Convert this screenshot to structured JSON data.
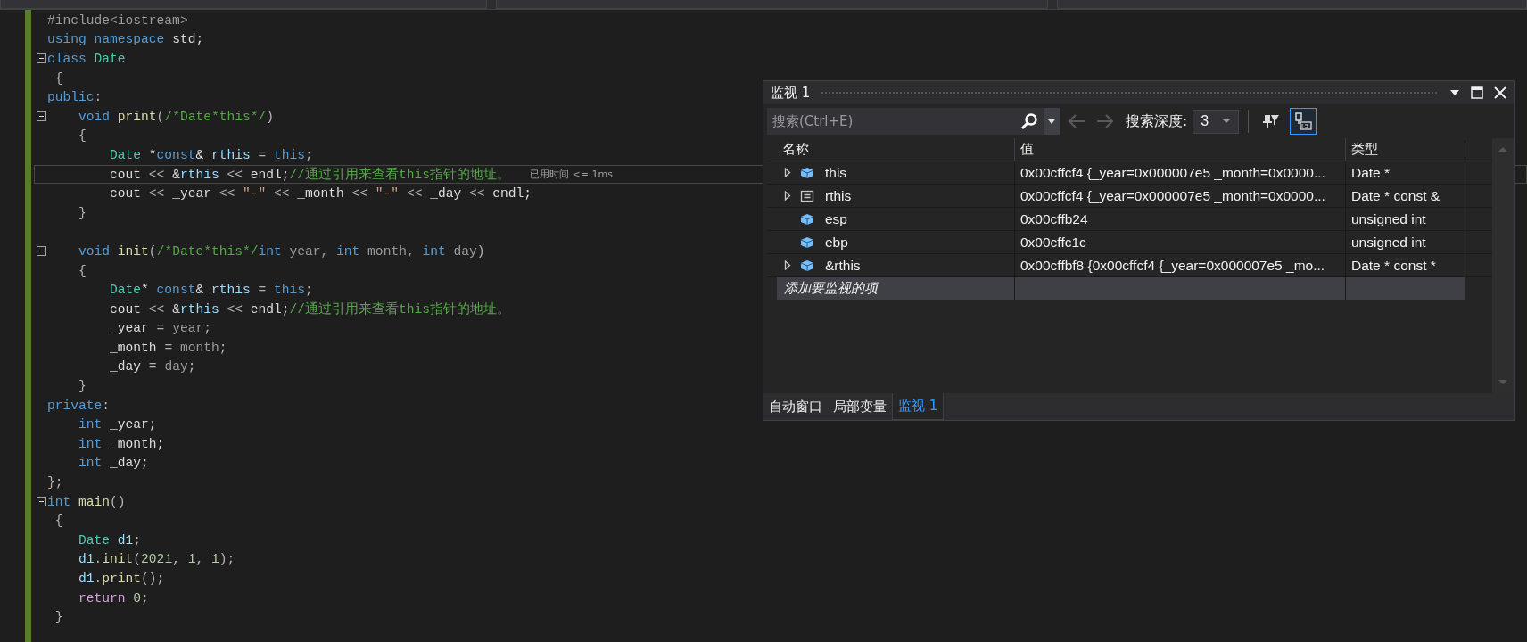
{
  "top_bar": {
    "dropdowns": [
      {
        "selected": false
      },
      {
        "selected": false
      },
      {
        "selected": false
      }
    ]
  },
  "code": {
    "lines": [
      {
        "tokens": [
          {
            "kind": "pp",
            "text": "#include<iostream>"
          }
        ]
      },
      {
        "tokens": [
          {
            "kind": "kw",
            "text": "using namespace"
          },
          {
            "kind": "plain",
            "text": " std;"
          }
        ]
      },
      {
        "fold": true,
        "tokens": [
          {
            "kind": "kw",
            "text": "class"
          },
          {
            "kind": "type",
            "text": " Date"
          }
        ]
      },
      {
        "tokens": [
          {
            "kind": "punct",
            "text": " {"
          }
        ]
      },
      {
        "tokens": [
          {
            "kind": "kw",
            "text": "public"
          },
          {
            "kind": "punct",
            "text": ":"
          }
        ]
      },
      {
        "fold": true,
        "tokens": [
          {
            "kind": "kw",
            "text": "    void"
          },
          {
            "kind": "fn",
            "text": " print"
          },
          {
            "kind": "punct",
            "text": "("
          },
          {
            "kind": "comment",
            "text": "/*Date*this*/"
          },
          {
            "kind": "punct",
            "text": ")"
          }
        ]
      },
      {
        "tokens": [
          {
            "kind": "punct",
            "text": "    {"
          }
        ]
      },
      {
        "tokens": [
          {
            "kind": "type",
            "text": "        Date"
          },
          {
            "kind": "plain",
            "text": " *"
          },
          {
            "kind": "kw",
            "text": "const"
          },
          {
            "kind": "plain",
            "text": "& "
          },
          {
            "kind": "var",
            "text": "rthis"
          },
          {
            "kind": "punct",
            "text": " = "
          },
          {
            "kind": "kw",
            "text": "this"
          },
          {
            "kind": "punct",
            "text": ";"
          }
        ]
      },
      {
        "current": true,
        "tip": "已用时间 <= 1ms",
        "tokens": [
          {
            "kind": "plain",
            "text": "        cout "
          },
          {
            "kind": "punct",
            "text": "<<"
          },
          {
            "kind": "plain",
            "text": " &"
          },
          {
            "kind": "var",
            "text": "rthis"
          },
          {
            "kind": "punct",
            "text": " << "
          },
          {
            "kind": "plain",
            "text": "endl;"
          },
          {
            "kind": "comment",
            "text": "//通过引用来查看this指针的地址。"
          }
        ]
      },
      {
        "tokens": [
          {
            "kind": "plain",
            "text": "        cout "
          },
          {
            "kind": "punct",
            "text": "<<"
          },
          {
            "kind": "plain",
            "text": " _year "
          },
          {
            "kind": "punct",
            "text": "<<"
          },
          {
            "kind": "string",
            "text": " \"-\" "
          },
          {
            "kind": "punct",
            "text": "<<"
          },
          {
            "kind": "plain",
            "text": " _month "
          },
          {
            "kind": "punct",
            "text": "<<"
          },
          {
            "kind": "string",
            "text": " \"-\" "
          },
          {
            "kind": "punct",
            "text": "<<"
          },
          {
            "kind": "plain",
            "text": " _day "
          },
          {
            "kind": "punct",
            "text": "<<"
          },
          {
            "kind": "plain",
            "text": " endl;"
          }
        ]
      },
      {
        "tokens": [
          {
            "kind": "punct",
            "text": "    }"
          }
        ]
      },
      {
        "fold": true,
        "blank_before": true,
        "tokens": [
          {
            "kind": "kw",
            "text": "    void"
          },
          {
            "kind": "fn",
            "text": " init"
          },
          {
            "kind": "punct",
            "text": "("
          },
          {
            "kind": "comment",
            "text": "/*Date*this*/"
          },
          {
            "kind": "kw",
            "text": "int"
          },
          {
            "kind": "param",
            "text": " year, "
          },
          {
            "kind": "kw",
            "text": "int"
          },
          {
            "kind": "param",
            "text": " month, "
          },
          {
            "kind": "kw",
            "text": "int"
          },
          {
            "kind": "param",
            "text": " day"
          },
          {
            "kind": "punct",
            "text": ")"
          }
        ]
      },
      {
        "tokens": [
          {
            "kind": "punct",
            "text": "    {"
          }
        ]
      },
      {
        "tokens": [
          {
            "kind": "type",
            "text": "        Date"
          },
          {
            "kind": "plain",
            "text": "* "
          },
          {
            "kind": "kw",
            "text": "const"
          },
          {
            "kind": "plain",
            "text": "& "
          },
          {
            "kind": "var",
            "text": "rthis"
          },
          {
            "kind": "punct",
            "text": " = "
          },
          {
            "kind": "kw",
            "text": "this"
          },
          {
            "kind": "punct",
            "text": ";"
          }
        ]
      },
      {
        "tokens": [
          {
            "kind": "plain",
            "text": "        cout "
          },
          {
            "kind": "punct",
            "text": "<<"
          },
          {
            "kind": "plain",
            "text": " &"
          },
          {
            "kind": "var",
            "text": "rthis"
          },
          {
            "kind": "punct",
            "text": " << "
          },
          {
            "kind": "plain",
            "text": "endl;"
          },
          {
            "kind": "comment",
            "text": "//通过引用来查看this指针的地址。"
          }
        ]
      },
      {
        "tokens": [
          {
            "kind": "plain",
            "text": "        _year "
          },
          {
            "kind": "punct",
            "text": "= "
          },
          {
            "kind": "param",
            "text": "year"
          },
          {
            "kind": "punct",
            "text": ";"
          }
        ]
      },
      {
        "tokens": [
          {
            "kind": "plain",
            "text": "        _month "
          },
          {
            "kind": "punct",
            "text": "= "
          },
          {
            "kind": "param",
            "text": "month"
          },
          {
            "kind": "punct",
            "text": ";"
          }
        ]
      },
      {
        "tokens": [
          {
            "kind": "plain",
            "text": "        _day "
          },
          {
            "kind": "punct",
            "text": "= "
          },
          {
            "kind": "param",
            "text": "day"
          },
          {
            "kind": "punct",
            "text": ";"
          }
        ]
      },
      {
        "tokens": [
          {
            "kind": "punct",
            "text": "    }"
          }
        ]
      },
      {
        "tokens": [
          {
            "kind": "kw",
            "text": "private"
          },
          {
            "kind": "punct",
            "text": ":"
          }
        ]
      },
      {
        "tokens": [
          {
            "kind": "kw",
            "text": "    int"
          },
          {
            "kind": "plain",
            "text": " _year;"
          }
        ]
      },
      {
        "tokens": [
          {
            "kind": "kw",
            "text": "    int"
          },
          {
            "kind": "plain",
            "text": " _month;"
          }
        ]
      },
      {
        "tokens": [
          {
            "kind": "kw",
            "text": "    int"
          },
          {
            "kind": "plain",
            "text": " _day;"
          }
        ]
      },
      {
        "tokens": [
          {
            "kind": "punct",
            "text": "};"
          }
        ]
      },
      {
        "fold": true,
        "tokens": [
          {
            "kind": "kw",
            "text": "int"
          },
          {
            "kind": "fn",
            "text": " main"
          },
          {
            "kind": "punct",
            "text": "()"
          }
        ]
      },
      {
        "tokens": [
          {
            "kind": "punct",
            "text": " {"
          }
        ]
      },
      {
        "tokens": [
          {
            "kind": "type",
            "text": "    Date"
          },
          {
            "kind": "var",
            "text": " d1"
          },
          {
            "kind": "punct",
            "text": ";"
          }
        ]
      },
      {
        "tokens": [
          {
            "kind": "var",
            "text": "    d1"
          },
          {
            "kind": "punct",
            "text": "."
          },
          {
            "kind": "fn",
            "text": "init"
          },
          {
            "kind": "punct",
            "text": "("
          },
          {
            "kind": "num",
            "text": "2021"
          },
          {
            "kind": "punct",
            "text": ", "
          },
          {
            "kind": "num",
            "text": "1"
          },
          {
            "kind": "punct",
            "text": ", "
          },
          {
            "kind": "num",
            "text": "1"
          },
          {
            "kind": "punct",
            "text": ");"
          }
        ]
      },
      {
        "tokens": [
          {
            "kind": "var",
            "text": "    d1"
          },
          {
            "kind": "punct",
            "text": "."
          },
          {
            "kind": "fn",
            "text": "print"
          },
          {
            "kind": "punct",
            "text": "();"
          }
        ]
      },
      {
        "tokens": [
          {
            "kind": "ret",
            "text": "    return"
          },
          {
            "kind": "num",
            "text": " 0"
          },
          {
            "kind": "punct",
            "text": ";"
          }
        ]
      },
      {
        "tokens": [
          {
            "kind": "punct",
            "text": " }"
          }
        ]
      }
    ]
  },
  "watch": {
    "title": "监视 1",
    "search": {
      "placeholder": "搜索(Ctrl+E)"
    },
    "nav": [
      {
        "disabled": true
      },
      {
        "disabled": true
      }
    ],
    "depth_label": "搜索深度:",
    "depth": "3",
    "tools": [
      {
        "kind": "pin-filter",
        "selected": false
      },
      {
        "kind": "tab-view",
        "selected": true
      }
    ],
    "columns": [
      "名称",
      "值",
      "类型"
    ],
    "rows": [
      {
        "expandable": true,
        "kind": "object",
        "name": "this",
        "value": "0x00cffcf4 {_year=0x000007e5 _month=0x0000...",
        "type": "Date *"
      },
      {
        "expandable": true,
        "kind": "reference",
        "name": "rthis",
        "value": "0x00cffcf4 {_year=0x000007e5 _month=0x0000...",
        "type": "Date * const &"
      },
      {
        "expandable": false,
        "kind": "object",
        "name": "esp",
        "value": "0x00cffb24",
        "type": "unsigned int"
      },
      {
        "expandable": false,
        "kind": "object",
        "name": "ebp",
        "value": "0x00cffc1c",
        "type": "unsigned int"
      },
      {
        "expandable": true,
        "kind": "object",
        "name": "&rthis",
        "value": "0x00cffbf8 {0x00cffcf4 {_year=0x000007e5 _mo...",
        "type": "Date * const *"
      }
    ],
    "add_row": "添加要监视的项",
    "tabs": [
      {
        "label": "自动窗口",
        "selected": false
      },
      {
        "label": "局部变量",
        "selected": false
      },
      {
        "label": "监视 1",
        "selected": true
      }
    ]
  }
}
